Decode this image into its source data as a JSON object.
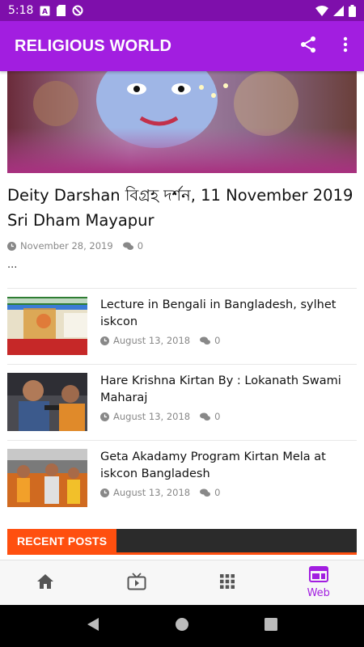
{
  "status_bar": {
    "time": "5:18"
  },
  "app_bar": {
    "title": "RELIGIOUS WORLD",
    "icons": [
      "share-icon",
      "more-vert-icon"
    ]
  },
  "featured": {
    "title": "Deity Darshan বিগ্রহ দর্শন, 11 November 2019 Sri Dham Mayapur",
    "date": "November 28, 2019",
    "comments": "0",
    "excerpt": "..."
  },
  "posts": [
    {
      "title": "Lecture in Bengali in Bangladesh, sylhet iskcon",
      "date": "August 13, 2018",
      "comments": "0"
    },
    {
      "title": "Hare Krishna Kirtan By : Lokanath Swami Maharaj",
      "date": "August 13, 2018",
      "comments": "0"
    },
    {
      "title": "Geta Akadamy Program Kirtan Mela at iskcon Bangladesh",
      "date": "August 13, 2018",
      "comments": "0"
    }
  ],
  "recent_posts": {
    "label": "RECENT POSTS"
  },
  "bottom_nav": {
    "items": [
      {
        "icon": "home-icon",
        "label": ""
      },
      {
        "icon": "tv-icon",
        "label": ""
      },
      {
        "icon": "grid-icon",
        "label": ""
      },
      {
        "icon": "web-icon",
        "label": "Web",
        "active": true
      }
    ]
  },
  "colors": {
    "status_bar": "#7e0fab",
    "app_bar": "#a21ee0",
    "accent": "#ff4f0f",
    "recent_bar": "#2b2b2b"
  }
}
